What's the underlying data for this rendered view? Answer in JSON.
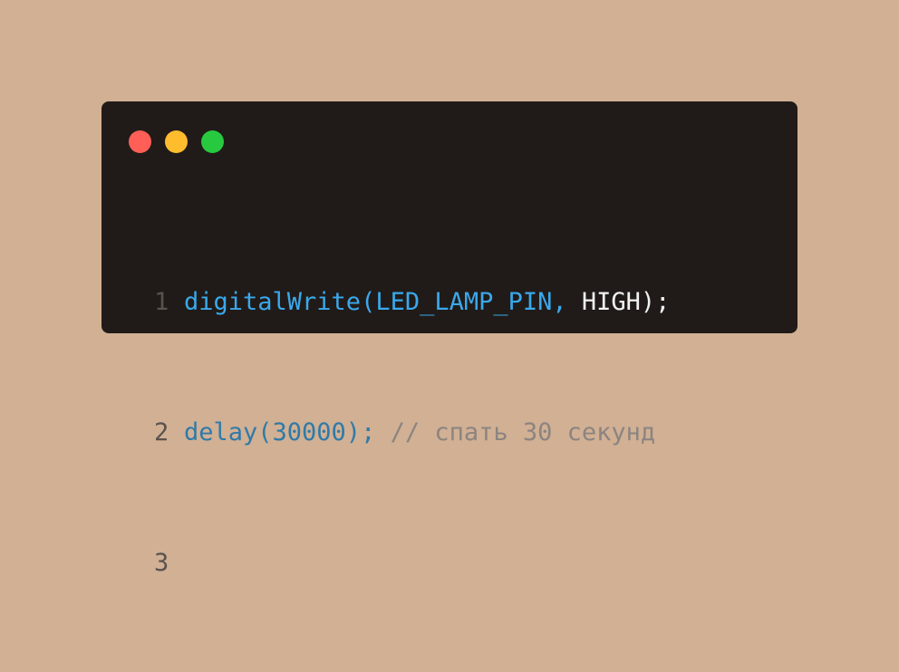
{
  "window": {
    "traffic_lights": [
      {
        "name": "close",
        "color": "#ff5f56"
      },
      {
        "name": "minimize",
        "color": "#ffbd2e"
      },
      {
        "name": "maximize",
        "color": "#27c93f"
      }
    ]
  },
  "code": {
    "lines": [
      {
        "number": "1",
        "segments": [
          {
            "text": "digitalWrite(LED_LAMP_PIN, ",
            "style": "func"
          },
          {
            "text": "HIGH);",
            "style": "plain"
          }
        ]
      },
      {
        "number": "2",
        "segments": [
          {
            "text": "delay(30000);",
            "style": "dim"
          },
          {
            "text": " // спать 30 секунд",
            "style": "comment"
          }
        ]
      },
      {
        "number": "3",
        "segments": []
      }
    ]
  },
  "colors": {
    "background": "#d1b094",
    "editor_bg": "#201b18",
    "function": "#3aa9ec",
    "plain": "#f2f2f2",
    "dim": "#2f7aa8",
    "comment": "#8c8480",
    "line_number": "#5a524d"
  }
}
